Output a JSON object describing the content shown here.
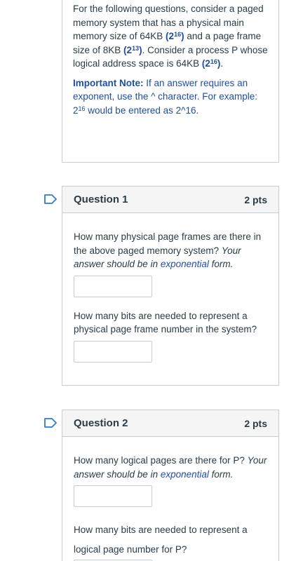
{
  "intro": {
    "para1_a": "For the following questions, consider a paged memory system that has a physical main memory size of 64KB ",
    "para1_b": "2",
    "para1_c": "16",
    "para1_d": " and a  page frame size of 8KB ",
    "para1_e": "13",
    "para1_f": ". Consider a process P whose logical address space is 64KB ",
    "para1_g": "16",
    "note_label": "Important Note:",
    "note_text": " If an answer requires an exponent, use the ^ character.  For example: 2",
    "note_sup": "16",
    "note_tail": " would be entered as 2^16."
  },
  "questions": [
    {
      "title": "Question 1",
      "points": "2 pts",
      "part1": "How many physical page frames are there in the above paged memory system? ",
      "part1_italic_a": "Your answer should be in ",
      "part1_italic_b": "exponential",
      "part1_italic_c": " form.",
      "part2": "How many bits are needed to represent a physical page frame number in the system?"
    },
    {
      "title": "Question 2",
      "points": "2 pts",
      "part1": "How many logical pages are there for P? ",
      "part1_italic_a": "Your answer should be in ",
      "part1_italic_b": "exponential",
      "part1_italic_c": " form.",
      "part2": "How many bits are needed to represent a logical page number for P?"
    }
  ],
  "colors": {
    "accent": "#1f4ea3",
    "border": "#c7cdd1",
    "header_bg": "#f5f5f5",
    "flag": "#2b7bd3"
  }
}
